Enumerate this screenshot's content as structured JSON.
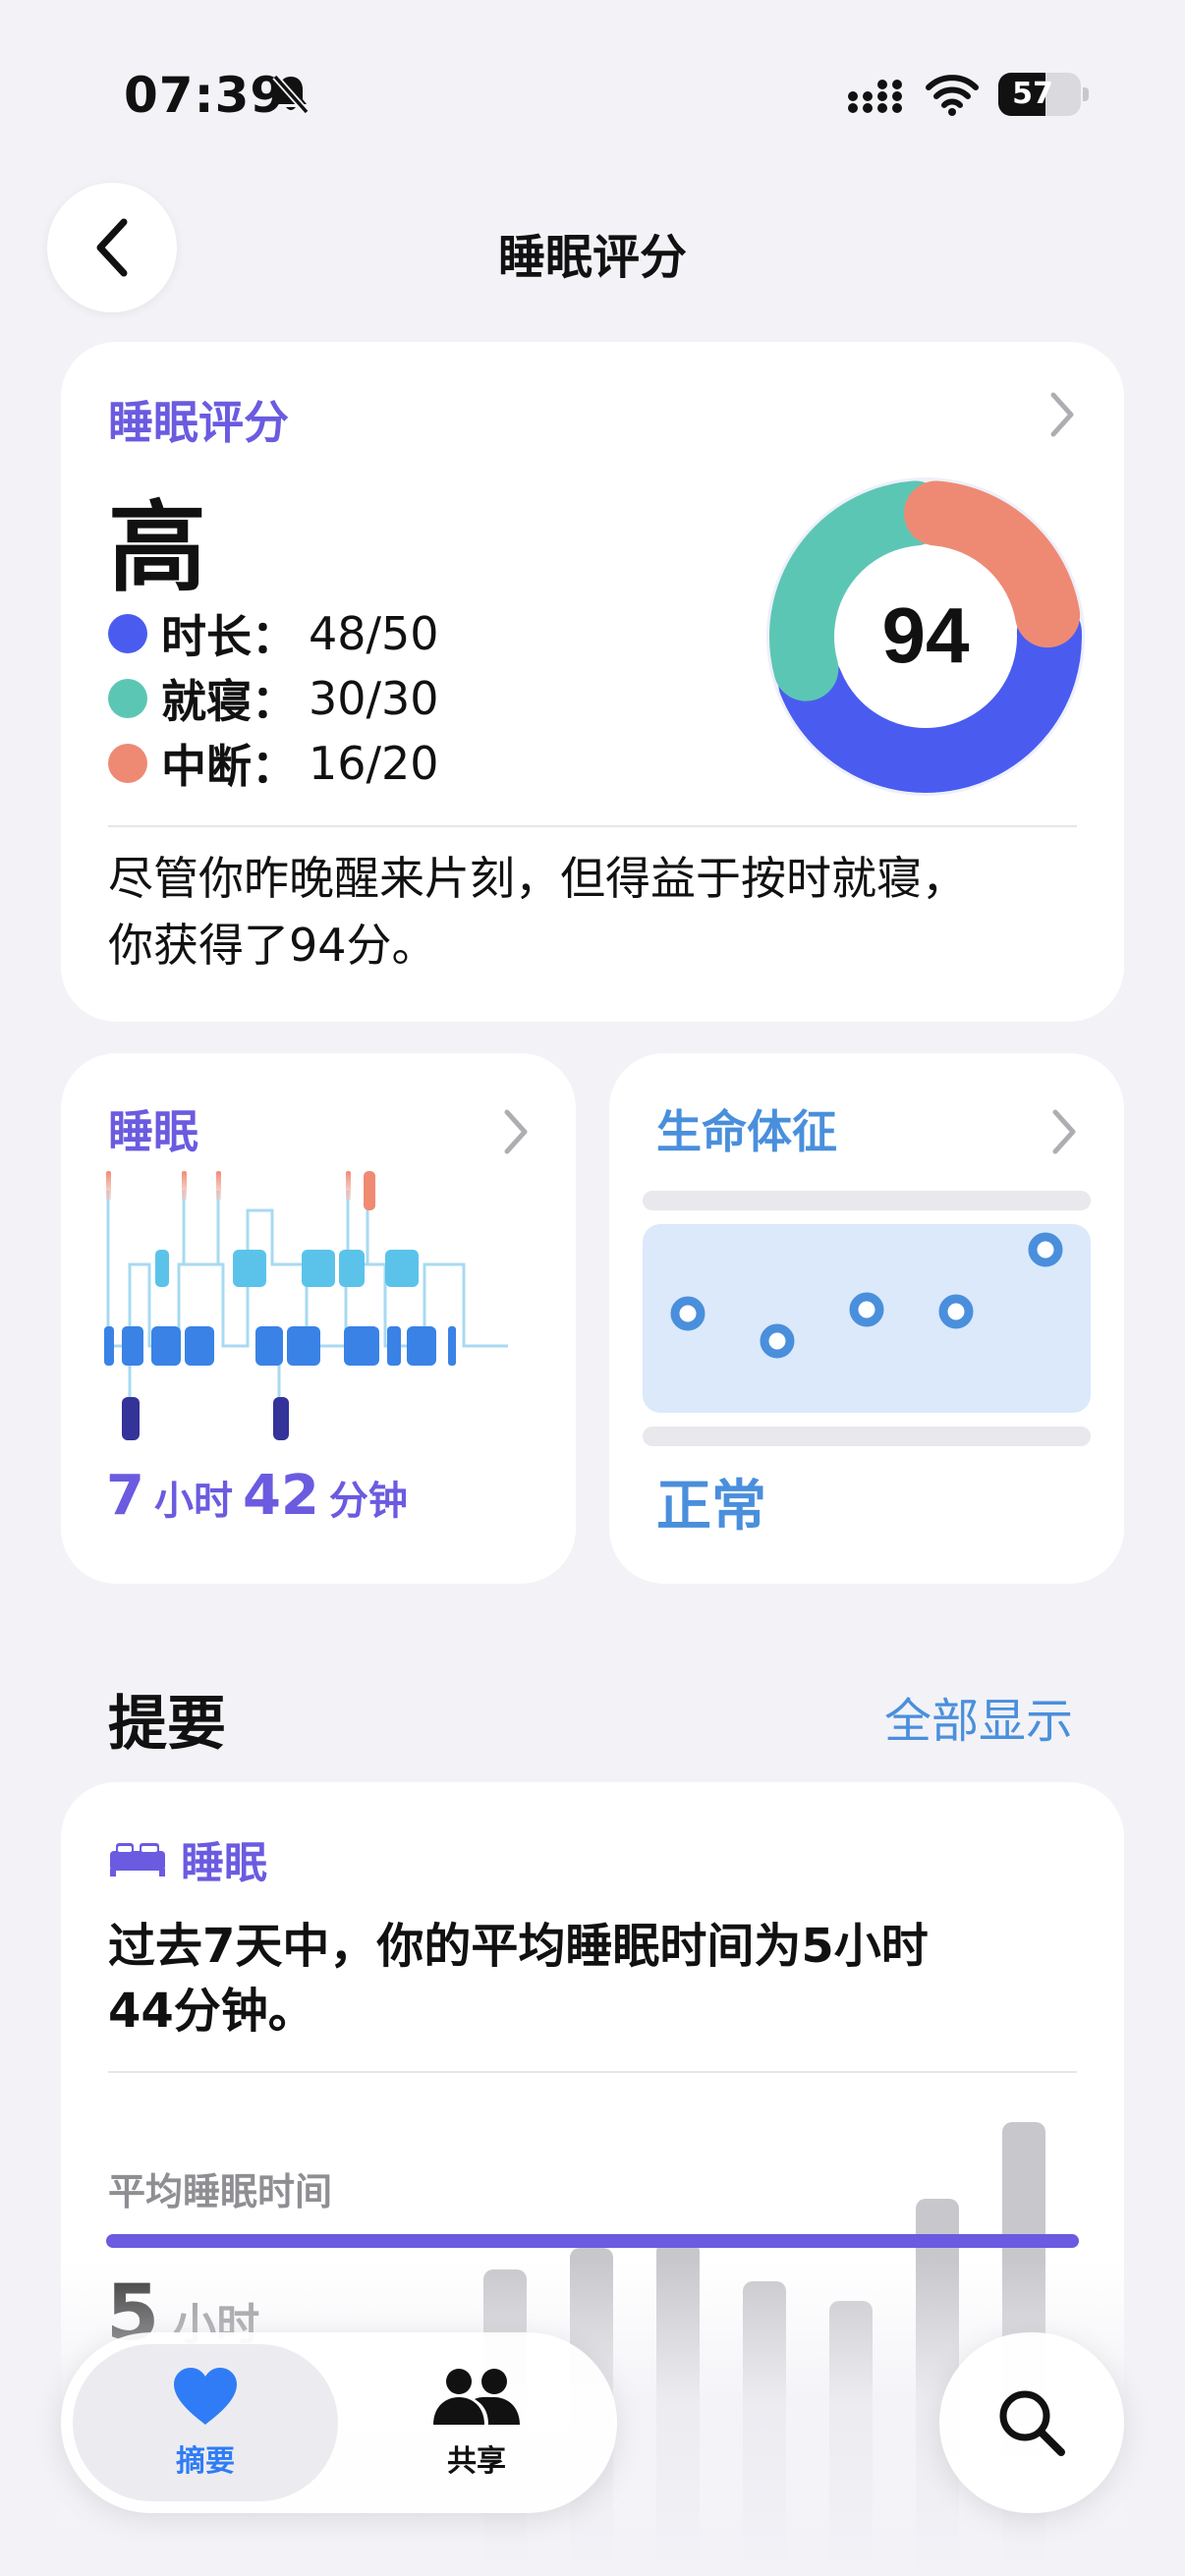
{
  "status_bar": {
    "time": "07:39",
    "battery": "57",
    "battery_level": 0.57
  },
  "nav": {
    "title": "睡眠评分"
  },
  "score_card": {
    "label": "睡眠评分",
    "level": "高",
    "score": "94",
    "metrics": [
      {
        "name": "时长：",
        "value": "48/50",
        "color": "#4a5cf0"
      },
      {
        "name": "就寝：",
        "value": "30/30",
        "color": "#5cc6b4"
      },
      {
        "name": "中断：",
        "value": "16/20",
        "color": "#ee8a74"
      }
    ],
    "summary_line1": "尽管你昨晚醒来片刻，但得益于按时就寝，",
    "summary_line2": "你获得了94分。"
  },
  "sleep_card": {
    "label": "睡眠",
    "hours": "7",
    "hours_unit": "小时",
    "minutes": "42",
    "minutes_unit": "分钟"
  },
  "vitals_card": {
    "label": "生命体征",
    "status": "正常"
  },
  "summary_section": {
    "title": "提要",
    "show_all": "全部显示"
  },
  "summary_card": {
    "category": "睡眠",
    "text_line1": "过去7天中，你的平均睡眠时间为5小时",
    "text_line2": "44分钟。",
    "avg_label": "平均睡眠时间",
    "avg_hours": "5",
    "avg_unit": "小时"
  },
  "tabbar": {
    "tabs": [
      {
        "label": "摘要",
        "active": true
      },
      {
        "label": "共享",
        "active": false
      }
    ]
  },
  "colors": {
    "accent_purple": "#6b5be0",
    "accent_blue": "#4a8fdc",
    "tab_active": "#2f7cf6"
  }
}
